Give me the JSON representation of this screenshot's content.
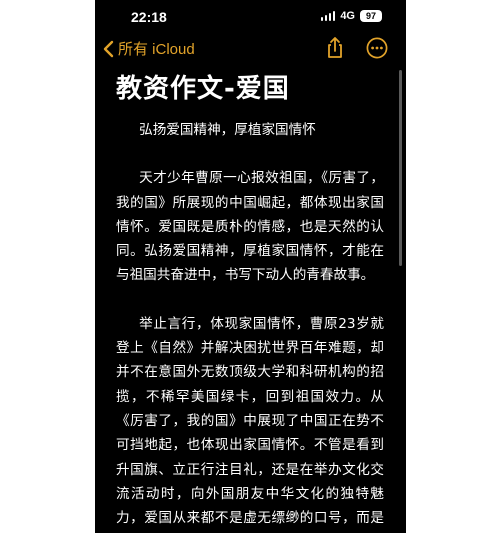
{
  "status_bar": {
    "time": "22:18",
    "network": "4G",
    "battery": "97"
  },
  "nav": {
    "back_label": "所有 iCloud",
    "icons": [
      "chevron-left-icon",
      "share-icon",
      "more-icon"
    ]
  },
  "document": {
    "title": "教资作文-爱国",
    "paragraphs": [
      "弘扬爱国精神，厚植家国情怀",
      "天才少年曹原一心报效祖国，《厉害了，我的国》所展现的中国崛起，都体现出家国情怀。爱国既是质朴的情感，也是天然的认同。弘扬爱国精神，厚植家国情怀，才能在与祖国共奋进中，书写下动人的青春故事。",
      "举止言行，体现家国情怀，曹原23岁就登上《自然》并解决困扰世界百年难题，却并不在意国外无数顶级大学和科研机构的招揽，不稀罕美国绿卡，回到祖国效力。从《厉害了，我的国》中展现了中国正在势不可挡地起，也体现出家国情怀。不管是看到升国旗、立正行注目礼，还是在举办文化交流活动时，向外国朋友中华文化的独特魅力，爱国从来都不是虚无缥缈的口号，而是生动地存在于点滴生活细节之中。"
    ]
  },
  "colors": {
    "background": "#000000",
    "text": "#ffffff",
    "accent": "#e2a32a"
  }
}
